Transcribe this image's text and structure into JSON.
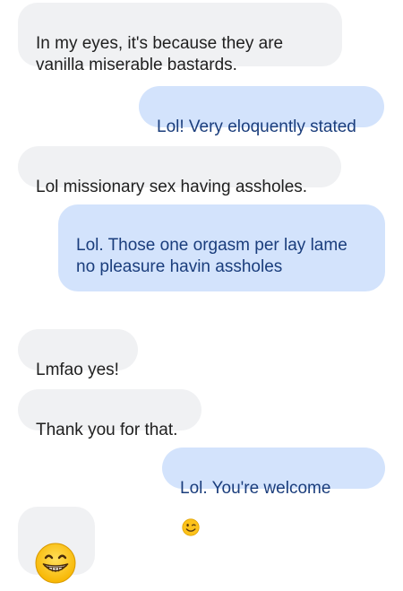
{
  "messages": [
    {
      "id": "m1",
      "sender": "other",
      "text": "In my eyes, it's because they are\nvanilla miserable bastards."
    },
    {
      "id": "m2",
      "sender": "self",
      "text": "Lol! Very eloquently stated"
    },
    {
      "id": "m3",
      "sender": "other",
      "text": "Lol missionary sex having assholes."
    },
    {
      "id": "m4",
      "sender": "self",
      "text": "Lol. Those one orgasm per lay lame\nno pleasure havin assholes"
    },
    {
      "id": "m5",
      "sender": "other",
      "text": "Lmfao yes!"
    },
    {
      "id": "m6",
      "sender": "other",
      "text": "Thank you for that."
    },
    {
      "id": "m7",
      "sender": "self",
      "text": "Lol. You're welcome",
      "emoji": "winking-face-emoji"
    },
    {
      "id": "m8",
      "sender": "other",
      "text": "",
      "emoji": "grinning-face-emoji"
    }
  ],
  "colors": {
    "received_bubble": "#f0f1f3",
    "received_text": "#1f1f1f",
    "sent_bubble": "#d3e3fc",
    "sent_text": "#1a3d7c",
    "emoji_yellow": "#fcc21b"
  }
}
